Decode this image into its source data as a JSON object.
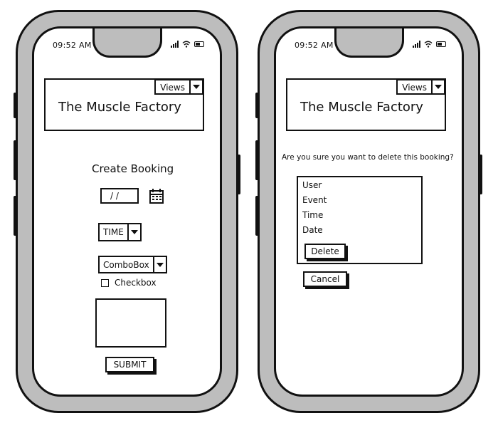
{
  "status_bar": {
    "time": "09:52 AM"
  },
  "app": {
    "title": "The Muscle Factory",
    "views_label": "Views"
  },
  "booking_screen": {
    "heading": "Create Booking",
    "date_value": "/ /",
    "time_label": "TIME",
    "combobox_label": "ComboBox",
    "checkbox_label": "Checkbox",
    "submit_label": "SUBMIT"
  },
  "delete_screen": {
    "question": "Are you sure you want to delete this booking?",
    "fields": [
      "User",
      "Event",
      "Time",
      "Date"
    ],
    "delete_label": "Delete",
    "cancel_label": "Cancel"
  }
}
